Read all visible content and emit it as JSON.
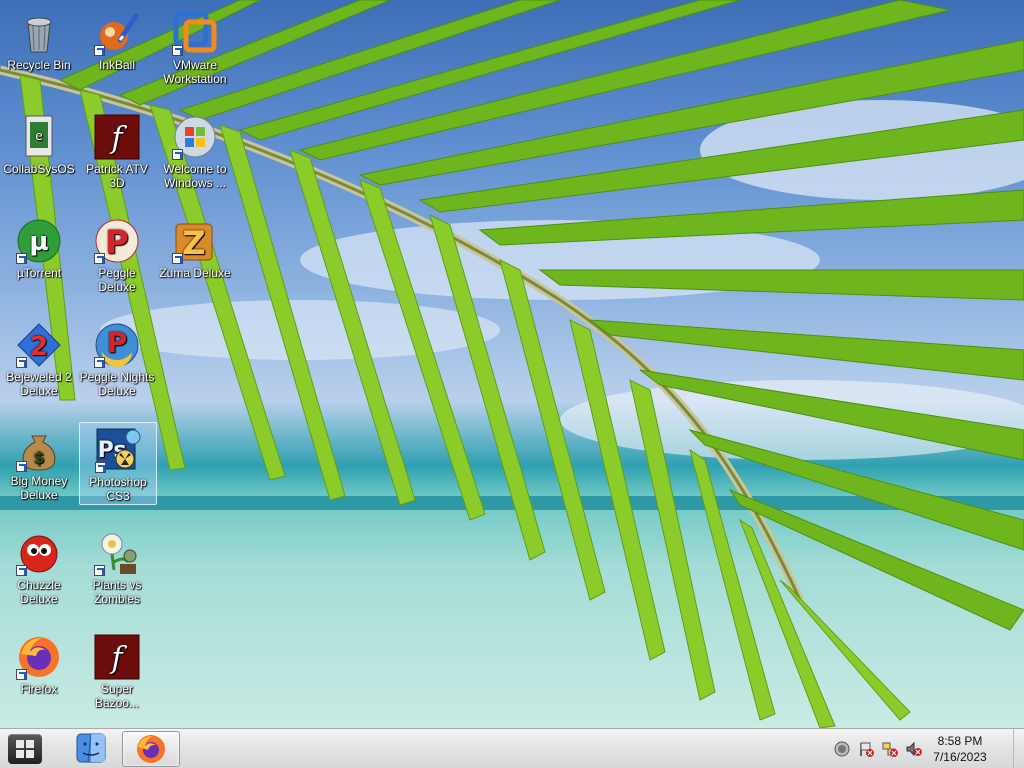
{
  "desktop": {
    "icons": [
      {
        "label": "Recycle Bin",
        "icon": "recycle-bin-icon"
      },
      {
        "label": "InkBall",
        "icon": "inkball-icon"
      },
      {
        "label": "VMware Workstation",
        "icon": "vmware-icon"
      },
      {
        "label": "CollabSysOS",
        "icon": "collabsysos-icon"
      },
      {
        "label": "Patrick ATV 3D",
        "icon": "flash-icon"
      },
      {
        "label": "Welcome to Windows ...",
        "icon": "windows-orb-icon"
      },
      {
        "label": "µTorrent",
        "icon": "utorrent-icon"
      },
      {
        "label": "Peggle Deluxe",
        "icon": "peggle-icon"
      },
      {
        "label": "Zuma Deluxe",
        "icon": "zuma-icon"
      },
      {
        "label": "Bejeweled 2 Deluxe",
        "icon": "bejeweled-icon"
      },
      {
        "label": "Peggle Nights Deluxe",
        "icon": "peggle-nights-icon"
      },
      {
        "label": "Big Money Deluxe",
        "icon": "money-bag-icon"
      },
      {
        "label": "Photoshop CS3",
        "icon": "photoshop-icon"
      },
      {
        "label": "Chuzzle Deluxe",
        "icon": "chuzzle-icon"
      },
      {
        "label": "Plants vs Zombies",
        "icon": "plants-icon"
      },
      {
        "label": "Firefox",
        "icon": "firefox-icon"
      },
      {
        "label": "Super Bazoo...",
        "icon": "flash-icon"
      }
    ]
  },
  "taskbar": {
    "start_icon": "windows-logo-icon",
    "pinned": [
      "finder-icon",
      "firefox-icon"
    ],
    "tray_icons": [
      "clock-tray-icon",
      "flag-tray-icon",
      "network-tray-icon",
      "volume-muted-icon"
    ],
    "time": "8:58 PM",
    "date": "7/16/2023"
  }
}
